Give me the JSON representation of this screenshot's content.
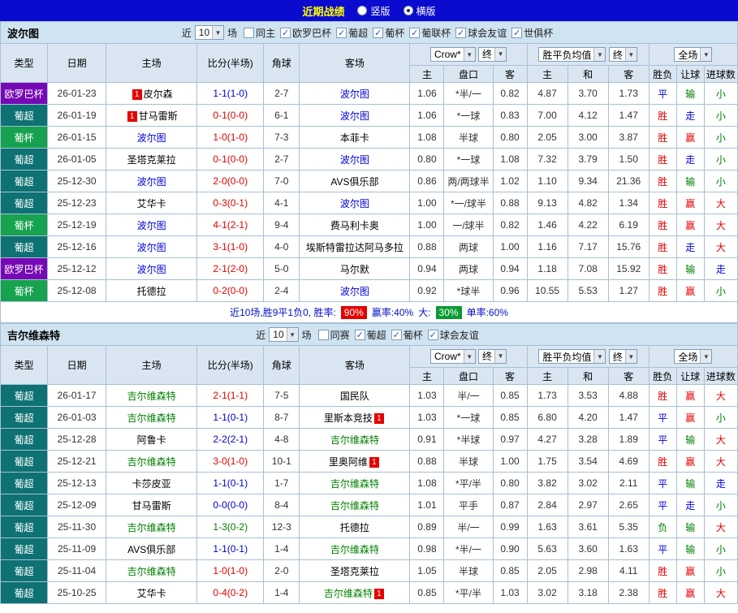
{
  "topbar": {
    "title": "近期战绩",
    "vertical": "竖版",
    "horizontal": "横版",
    "selected": "横版"
  },
  "labels": {
    "near": "近",
    "games": "场"
  },
  "colors": {
    "win": "#e60000",
    "draw": "#0000dd",
    "lose": "#008000",
    "eu": "#7609b5",
    "pu": "#0e7173",
    "pb": "#17a24f",
    "topbar": "#0b0bcf",
    "title": "#ffff00",
    "self-blue": "#0000dd",
    "self-green": "#008000",
    "badge-green": "#0a9b32"
  },
  "table_header": {
    "type": "类型",
    "date": "日期",
    "home": "主场",
    "score": "比分(半场)",
    "corner": "角球",
    "away": "客场",
    "odds_home": "主",
    "handicap": "盘口",
    "odds_away": "客",
    "avg_home": "主",
    "avg_draw": "和",
    "avg_away": "客",
    "result": "胜负",
    "handicap_result": "让球",
    "goals": "进球数",
    "bookmaker": "Crow*",
    "final": "终",
    "avg_label": "胜平负均值",
    "fullmatch": "全场"
  },
  "sections": [
    {
      "team": "波尔图",
      "self_class": "self-blue",
      "count": "10",
      "filters": [
        {
          "label": "同主",
          "checked": false
        },
        {
          "label": "欧罗巴杯",
          "checked": true
        },
        {
          "label": "葡超",
          "checked": true
        },
        {
          "label": "葡杯",
          "checked": true
        },
        {
          "label": "葡联杯",
          "checked": true
        },
        {
          "label": "球会友谊",
          "checked": true
        },
        {
          "label": "世俱杯",
          "checked": true
        }
      ],
      "rows": [
        {
          "type": "欧罗巴杯",
          "tcls": "eu",
          "date": "26-01-23",
          "home": {
            "name": "皮尔森",
            "badge": "1",
            "badge_pos": "before"
          },
          "score": "1-1(1-0)",
          "score_c": "draw",
          "corner": "2-7",
          "away": {
            "name": "波尔图",
            "self": true
          },
          "odds": [
            "1.06",
            "*半/一",
            "0.82"
          ],
          "avg": [
            "4.87",
            "3.70",
            "1.73"
          ],
          "res": [
            [
              "平",
              "draw"
            ],
            [
              "输",
              "lose"
            ],
            [
              "小",
              "lose"
            ]
          ]
        },
        {
          "type": "葡超",
          "tcls": "pu",
          "date": "26-01-19",
          "home": {
            "name": "甘马雷斯",
            "badge": "1",
            "badge_pos": "before"
          },
          "score": "0-1(0-0)",
          "score_c": "win",
          "corner": "6-1",
          "away": {
            "name": "波尔图",
            "self": true
          },
          "odds": [
            "1.06",
            "*一球",
            "0.83"
          ],
          "avg": [
            "7.00",
            "4.12",
            "1.47"
          ],
          "res": [
            [
              "胜",
              "win"
            ],
            [
              "走",
              "draw"
            ],
            [
              "小",
              "lose"
            ]
          ]
        },
        {
          "type": "葡杯",
          "tcls": "pb",
          "date": "26-01-15",
          "home": {
            "name": "波尔图",
            "self": true
          },
          "score": "1-0(1-0)",
          "score_c": "win",
          "corner": "7-3",
          "away": {
            "name": "本菲卡"
          },
          "odds": [
            "1.08",
            "半球",
            "0.80"
          ],
          "avg": [
            "2.05",
            "3.00",
            "3.87"
          ],
          "res": [
            [
              "胜",
              "win"
            ],
            [
              "赢",
              "win"
            ],
            [
              "小",
              "lose"
            ]
          ]
        },
        {
          "type": "葡超",
          "tcls": "pu",
          "date": "26-01-05",
          "home": {
            "name": "圣塔克莱拉"
          },
          "score": "0-1(0-0)",
          "score_c": "win",
          "corner": "2-7",
          "away": {
            "name": "波尔图",
            "self": true
          },
          "odds": [
            "0.80",
            "*一球",
            "1.08"
          ],
          "avg": [
            "7.32",
            "3.79",
            "1.50"
          ],
          "res": [
            [
              "胜",
              "win"
            ],
            [
              "走",
              "draw"
            ],
            [
              "小",
              "lose"
            ]
          ]
        },
        {
          "type": "葡超",
          "tcls": "pu",
          "date": "25-12-30",
          "home": {
            "name": "波尔图",
            "self": true
          },
          "score": "2-0(0-0)",
          "score_c": "win",
          "corner": "7-0",
          "away": {
            "name": "AVS俱乐部"
          },
          "odds": [
            "0.86",
            "两/两球半",
            "1.02"
          ],
          "avg": [
            "1.10",
            "9.34",
            "21.36"
          ],
          "res": [
            [
              "胜",
              "win"
            ],
            [
              "输",
              "lose"
            ],
            [
              "小",
              "lose"
            ]
          ]
        },
        {
          "type": "葡超",
          "tcls": "pu",
          "date": "25-12-23",
          "home": {
            "name": "艾华卡"
          },
          "score": "0-3(0-1)",
          "score_c": "win",
          "corner": "4-1",
          "away": {
            "name": "波尔图",
            "self": true
          },
          "odds": [
            "1.00",
            "*一/球半",
            "0.88"
          ],
          "avg": [
            "9.13",
            "4.82",
            "1.34"
          ],
          "res": [
            [
              "胜",
              "win"
            ],
            [
              "赢",
              "win"
            ],
            [
              "大",
              "win"
            ]
          ]
        },
        {
          "type": "葡杯",
          "tcls": "pb",
          "date": "25-12-19",
          "home": {
            "name": "波尔图",
            "self": true
          },
          "score": "4-1(2-1)",
          "score_c": "win",
          "corner": "9-4",
          "away": {
            "name": "费马利卡奥"
          },
          "odds": [
            "1.00",
            "一/球半",
            "0.82"
          ],
          "avg": [
            "1.46",
            "4.22",
            "6.19"
          ],
          "res": [
            [
              "胜",
              "win"
            ],
            [
              "赢",
              "win"
            ],
            [
              "大",
              "win"
            ]
          ]
        },
        {
          "type": "葡超",
          "tcls": "pu",
          "date": "25-12-16",
          "home": {
            "name": "波尔图",
            "self": true
          },
          "score": "3-1(1-0)",
          "score_c": "win",
          "corner": "4-0",
          "away": {
            "name": "埃斯特雷拉达阿马多拉"
          },
          "odds": [
            "0.88",
            "两球",
            "1.00"
          ],
          "avg": [
            "1.16",
            "7.17",
            "15.76"
          ],
          "res": [
            [
              "胜",
              "win"
            ],
            [
              "走",
              "draw"
            ],
            [
              "大",
              "win"
            ]
          ]
        },
        {
          "type": "欧罗巴杯",
          "tcls": "eu",
          "date": "25-12-12",
          "home": {
            "name": "波尔图",
            "self": true
          },
          "score": "2-1(2-0)",
          "score_c": "win",
          "corner": "5-0",
          "away": {
            "name": "马尔默"
          },
          "odds": [
            "0.94",
            "两球",
            "0.94"
          ],
          "avg": [
            "1.18",
            "7.08",
            "15.92"
          ],
          "res": [
            [
              "胜",
              "win"
            ],
            [
              "输",
              "lose"
            ],
            [
              "走",
              "draw"
            ]
          ]
        },
        {
          "type": "葡杯",
          "tcls": "pb",
          "date": "25-12-08",
          "home": {
            "name": "托德拉"
          },
          "score": "0-2(0-0)",
          "score_c": "win",
          "corner": "2-4",
          "away": {
            "name": "波尔图",
            "self": true
          },
          "odds": [
            "0.92",
            "*球半",
            "0.96"
          ],
          "avg": [
            "10.55",
            "5.53",
            "1.27"
          ],
          "res": [
            [
              "胜",
              "win"
            ],
            [
              "赢",
              "win"
            ],
            [
              "小",
              "lose"
            ]
          ]
        }
      ],
      "summary": {
        "prefix": "近10场,胜9平1负0, 胜率:",
        "win_rate": "90%",
        "mid": "赢率:40%",
        "big_label": "大:",
        "big_rate": "30%",
        "suffix": "单率:60%"
      }
    },
    {
      "team": "吉尔维森特",
      "self_class": "self-green",
      "count": "10",
      "filters": [
        {
          "label": "同赛",
          "checked": false
        },
        {
          "label": "葡超",
          "checked": true
        },
        {
          "label": "葡杯",
          "checked": true
        },
        {
          "label": "球会友谊",
          "checked": true
        }
      ],
      "rows": [
        {
          "type": "葡超",
          "tcls": "pu",
          "date": "26-01-17",
          "home": {
            "name": "吉尔维森特",
            "self": true
          },
          "score": "2-1(1-1)",
          "score_c": "win",
          "corner": "7-5",
          "away": {
            "name": "国民队"
          },
          "odds": [
            "1.03",
            "半/一",
            "0.85"
          ],
          "avg": [
            "1.73",
            "3.53",
            "4.88"
          ],
          "res": [
            [
              "胜",
              "win"
            ],
            [
              "赢",
              "win"
            ],
            [
              "大",
              "win"
            ]
          ]
        },
        {
          "type": "葡超",
          "tcls": "pu",
          "date": "26-01-03",
          "home": {
            "name": "吉尔维森特",
            "self": true
          },
          "score": "1-1(0-1)",
          "score_c": "draw",
          "corner": "8-7",
          "away": {
            "name": "里斯本竞技",
            "badge": "1",
            "badge_pos": "after"
          },
          "odds": [
            "1.03",
            "*一球",
            "0.85"
          ],
          "avg": [
            "6.80",
            "4.20",
            "1.47"
          ],
          "res": [
            [
              "平",
              "draw"
            ],
            [
              "赢",
              "win"
            ],
            [
              "小",
              "lose"
            ]
          ]
        },
        {
          "type": "葡超",
          "tcls": "pu",
          "date": "25-12-28",
          "home": {
            "name": "阿鲁卡"
          },
          "score": "2-2(2-1)",
          "score_c": "draw",
          "corner": "4-8",
          "away": {
            "name": "吉尔维森特",
            "self": true
          },
          "odds": [
            "0.91",
            "*半球",
            "0.97"
          ],
          "avg": [
            "4.27",
            "3.28",
            "1.89"
          ],
          "res": [
            [
              "平",
              "draw"
            ],
            [
              "输",
              "lose"
            ],
            [
              "大",
              "win"
            ]
          ]
        },
        {
          "type": "葡超",
          "tcls": "pu",
          "date": "25-12-21",
          "home": {
            "name": "吉尔维森特",
            "self": true
          },
          "score": "3-0(1-0)",
          "score_c": "win",
          "corner": "10-1",
          "away": {
            "name": "里奥阿维",
            "badge": "1",
            "badge_pos": "after"
          },
          "odds": [
            "0.88",
            "半球",
            "1.00"
          ],
          "avg": [
            "1.75",
            "3.54",
            "4.69"
          ],
          "res": [
            [
              "胜",
              "win"
            ],
            [
              "赢",
              "win"
            ],
            [
              "大",
              "win"
            ]
          ]
        },
        {
          "type": "葡超",
          "tcls": "pu",
          "date": "25-12-13",
          "home": {
            "name": "卡莎皮亚"
          },
          "score": "1-1(0-1)",
          "score_c": "draw",
          "corner": "1-7",
          "away": {
            "name": "吉尔维森特",
            "self": true
          },
          "odds": [
            "1.08",
            "*平/半",
            "0.80"
          ],
          "avg": [
            "3.82",
            "3.02",
            "2.11"
          ],
          "res": [
            [
              "平",
              "draw"
            ],
            [
              "输",
              "lose"
            ],
            [
              "走",
              "draw"
            ]
          ]
        },
        {
          "type": "葡超",
          "tcls": "pu",
          "date": "25-12-09",
          "home": {
            "name": "甘马雷斯"
          },
          "score": "0-0(0-0)",
          "score_c": "draw",
          "corner": "8-4",
          "away": {
            "name": "吉尔维森特",
            "self": true
          },
          "odds": [
            "1.01",
            "平手",
            "0.87"
          ],
          "avg": [
            "2.84",
            "2.97",
            "2.65"
          ],
          "res": [
            [
              "平",
              "draw"
            ],
            [
              "走",
              "draw"
            ],
            [
              "小",
              "lose"
            ]
          ]
        },
        {
          "type": "葡超",
          "tcls": "pu",
          "date": "25-11-30",
          "home": {
            "name": "吉尔维森特",
            "self": true
          },
          "score": "1-3(0-2)",
          "score_c": "lose",
          "corner": "12-3",
          "away": {
            "name": "托德拉"
          },
          "odds": [
            "0.89",
            "半/一",
            "0.99"
          ],
          "avg": [
            "1.63",
            "3.61",
            "5.35"
          ],
          "res": [
            [
              "负",
              "lose"
            ],
            [
              "输",
              "lose"
            ],
            [
              "大",
              "win"
            ]
          ]
        },
        {
          "type": "葡超",
          "tcls": "pu",
          "date": "25-11-09",
          "home": {
            "name": "AVS俱乐部"
          },
          "score": "1-1(0-1)",
          "score_c": "draw",
          "corner": "1-4",
          "away": {
            "name": "吉尔维森特",
            "self": true
          },
          "odds": [
            "0.98",
            "*半/一",
            "0.90"
          ],
          "avg": [
            "5.63",
            "3.60",
            "1.63"
          ],
          "res": [
            [
              "平",
              "draw"
            ],
            [
              "输",
              "lose"
            ],
            [
              "小",
              "lose"
            ]
          ]
        },
        {
          "type": "葡超",
          "tcls": "pu",
          "date": "25-11-04",
          "home": {
            "name": "吉尔维森特",
            "self": true
          },
          "score": "1-0(1-0)",
          "score_c": "win",
          "corner": "2-0",
          "away": {
            "name": "圣塔克莱拉"
          },
          "odds": [
            "1.05",
            "半球",
            "0.85"
          ],
          "avg": [
            "2.05",
            "2.98",
            "4.11"
          ],
          "res": [
            [
              "胜",
              "win"
            ],
            [
              "赢",
              "win"
            ],
            [
              "小",
              "lose"
            ]
          ]
        },
        {
          "type": "葡超",
          "tcls": "pu",
          "date": "25-10-25",
          "home": {
            "name": "艾华卡"
          },
          "score": "0-4(0-2)",
          "score_c": "win",
          "corner": "1-4",
          "away": {
            "name": "吉尔维森特",
            "self": true,
            "badge": "1",
            "badge_pos": "after"
          },
          "odds": [
            "0.85",
            "*平/半",
            "1.03"
          ],
          "avg": [
            "3.02",
            "3.18",
            "2.38"
          ],
          "res": [
            [
              "胜",
              "win"
            ],
            [
              "赢",
              "win"
            ],
            [
              "大",
              "win"
            ]
          ]
        }
      ],
      "summary": null
    }
  ]
}
